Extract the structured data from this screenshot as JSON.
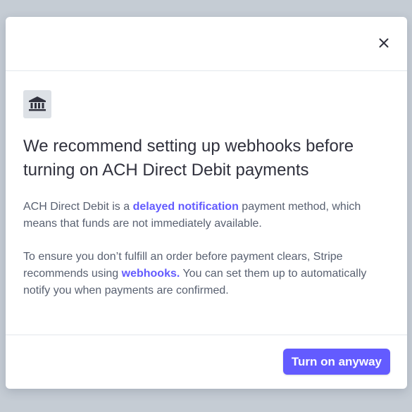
{
  "modal": {
    "close_icon": "close-icon",
    "bank_icon": "bank-icon",
    "title": "We recommend setting up webhooks before turning on ACH Direct Debit payments",
    "para1": {
      "before": "ACH Direct Debit is a ",
      "link": "delayed notification",
      "after": " payment method, which means that funds are not immediately available."
    },
    "para2": {
      "before": "To ensure you don’t fulfill an order before payment clears, Stripe recommends using ",
      "link": "webhooks.",
      "after": " You can set them up to automatically notify you when payments are confirmed."
    },
    "primary_button_label": "Turn on anyway"
  },
  "colors": {
    "accent": "#635bff",
    "title_text": "#30313d",
    "body_text": "#596171",
    "icon_box": "#dde1e6",
    "backdrop": "#c5ccd4"
  }
}
